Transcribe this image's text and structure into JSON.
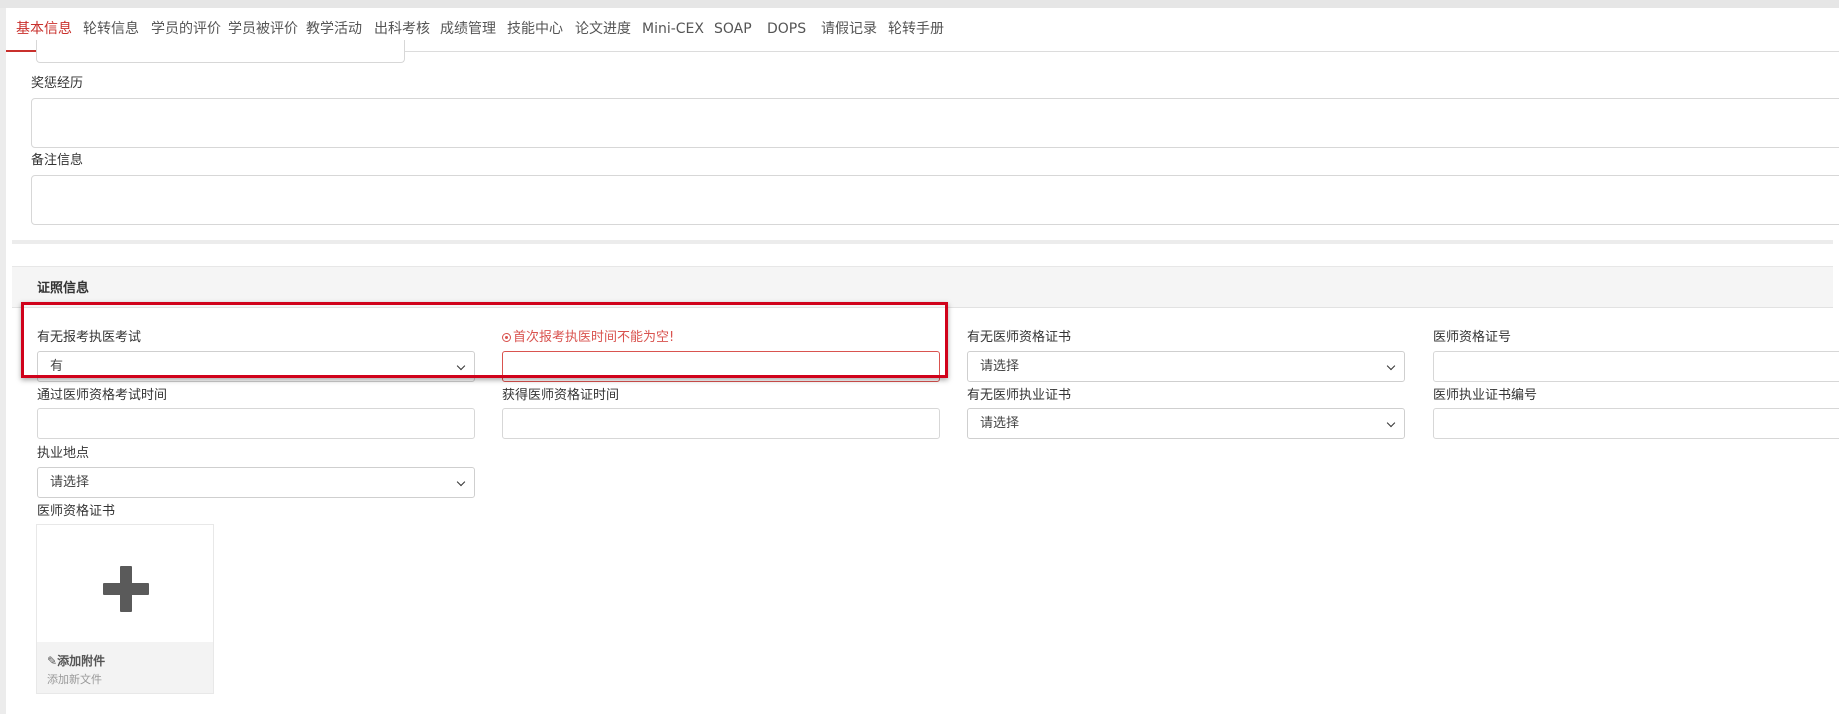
{
  "tabs": [
    {
      "label": "基本信息",
      "active": true
    },
    {
      "label": "轮转信息"
    },
    {
      "label": "学员的评价"
    },
    {
      "label": "学员被评价"
    },
    {
      "label": "教学活动"
    },
    {
      "label": "出科考核"
    },
    {
      "label": "成绩管理"
    },
    {
      "label": "技能中心"
    },
    {
      "label": "论文进度"
    },
    {
      "label": "Mini-CEX"
    },
    {
      "label": "SOAP"
    },
    {
      "label": "DOPS"
    },
    {
      "label": "请假记录"
    },
    {
      "label": "轮转手册"
    }
  ],
  "basic": {
    "awards_label": "奖惩经历",
    "remarks_label": "备注信息"
  },
  "license": {
    "section_title": "证照信息",
    "exam_label": "有无报考执医考试",
    "exam_value": "有",
    "first_exam_error": "首次报考执医时间不能为空!",
    "first_exam_value": "",
    "has_qual_label": "有无医师资格证书",
    "has_qual_value": "请选择",
    "qual_no_label": "医师资格证号",
    "qual_no_value": "",
    "pass_time_label": "通过医师资格考试时间",
    "obtain_time_label": "获得医师资格证时间",
    "has_practice_label": "有无医师执业证书",
    "has_practice_value": "请选择",
    "practice_no_label": "医师执业证书编号",
    "location_label": "执业地点",
    "location_value": "请选择",
    "cert_label": "医师资格证书",
    "upload_title": "添加附件",
    "upload_sub": "添加新文件"
  },
  "icons": {
    "chevron": "chevron-down-icon",
    "plus": "plus-icon",
    "paperclip": "paperclip-icon",
    "error": "error-circle-icon"
  },
  "colors": {
    "accent": "#c9302c",
    "error": "#d9534f",
    "highlight_box": "#d0021b"
  }
}
